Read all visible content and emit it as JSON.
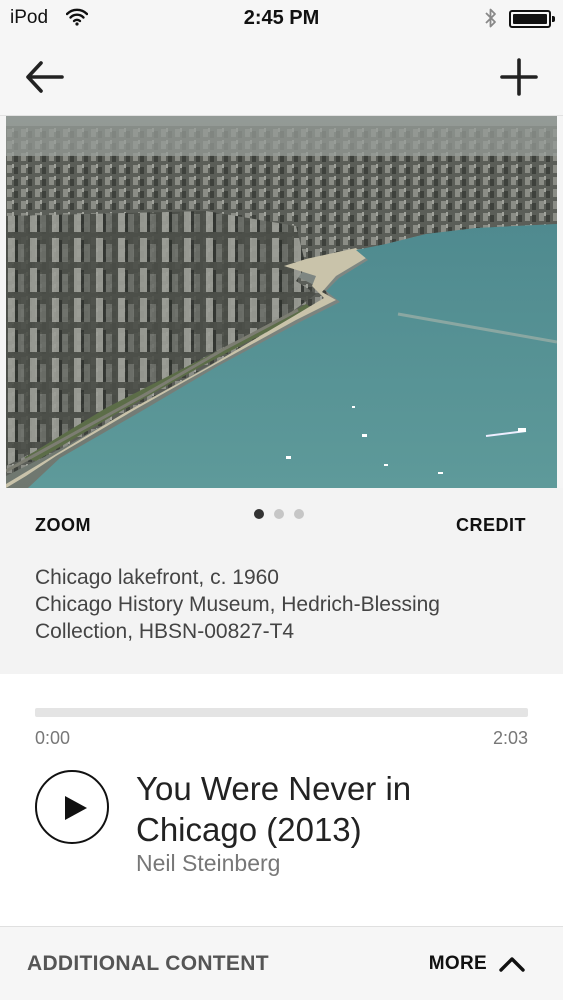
{
  "status_bar": {
    "carrier": "iPod",
    "time": "2:45 PM",
    "wifi_icon": "wifi-icon",
    "bluetooth_icon": "bluetooth-icon",
    "battery_icon": "battery-icon"
  },
  "nav": {
    "back_icon": "arrow-left-icon",
    "add_icon": "plus-icon"
  },
  "photo": {
    "subject": "aerial-city-lakefront-photo"
  },
  "gallery": {
    "zoom_label": "ZOOM",
    "credit_label": "CREDIT",
    "page_count": 3,
    "active_page": 1
  },
  "caption": {
    "line1": "Chicago lakefront, c. 1960",
    "line2": "Chicago History Museum, Hedrich-Blessing",
    "line3": "Collection, HBSN-00827-T4"
  },
  "player": {
    "elapsed": "0:00",
    "total": "2:03",
    "progress": 0,
    "title_line1": "You Were Never in",
    "title_line2": "Chicago (2013)",
    "author": "Neil Steinberg",
    "play_icon": "play-icon"
  },
  "bottom": {
    "additional_label": "ADDITIONAL CONTENT",
    "more_label": "MORE",
    "more_icon": "chevron-up-icon"
  },
  "colors": {
    "water": "#5e9a9a",
    "background": "#f5f5f5",
    "text_dark": "#222222",
    "text_muted": "#777777"
  }
}
